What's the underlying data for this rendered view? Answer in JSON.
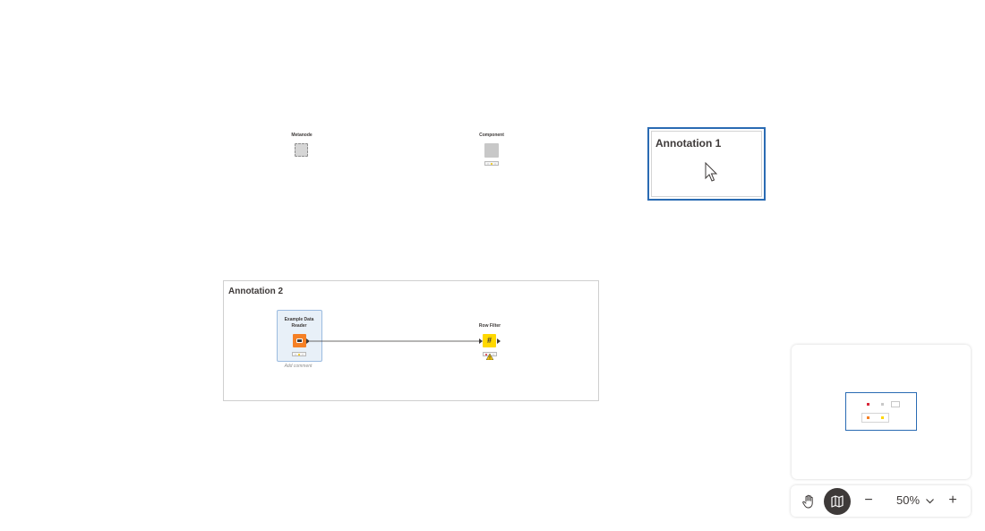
{
  "canvas": {
    "nodes": {
      "metanode": {
        "title": "Metanode"
      },
      "component": {
        "title": "Component"
      },
      "example_data_reader": {
        "title_line1": "Example Data",
        "title_line2": "Reader",
        "comment_placeholder": "Add comment"
      },
      "row_filter": {
        "title": "Row Filter"
      }
    },
    "annotations": {
      "annotation_1": {
        "title": "Annotation 1"
      },
      "annotation_2": {
        "title": "Annotation 2"
      }
    }
  },
  "toolbar": {
    "zoom_label": "50%",
    "zoom_out_symbol": "−",
    "zoom_in_symbol": "+",
    "pan_icon": "hand-icon",
    "minimap_icon": "map-icon",
    "zoom_dropdown_icon": "chevron-down-icon"
  },
  "colors": {
    "selection_blue": "#2a6bb3",
    "reader_orange": "#f58025",
    "manipulator_yellow": "#ffd800",
    "component_gray": "#c8c8c8",
    "text_dark": "#3e3a39"
  }
}
